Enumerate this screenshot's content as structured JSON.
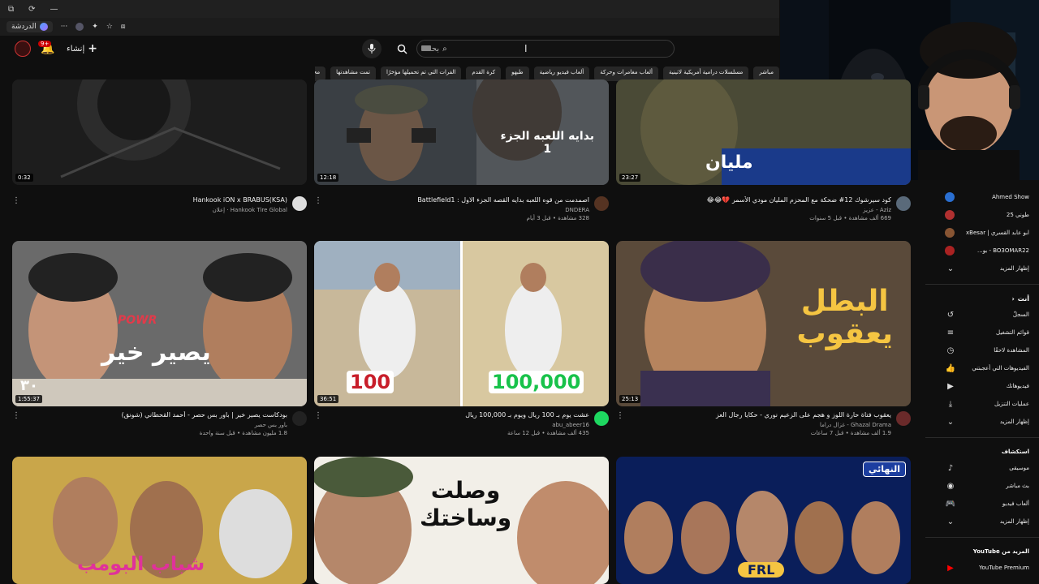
{
  "window": {
    "min": "—",
    "restore": "◻",
    "close": "▭"
  },
  "browser": {
    "profile_label": "الدردشة",
    "menu_dots": "···"
  },
  "header": {
    "create_label": "إنشاء",
    "notifications_count": "9+",
    "search_placeholder": "بحث"
  },
  "chips": [
    "مباشر",
    "مسلسلات درامية أمريكية لاتينية",
    "ألعاب مغامرات وحركة",
    "ألعاب فيديو رياضية",
    "طبهو",
    "كرة القدم",
    "الفرات التي تم تحميلها مؤخرًا",
    "تمت مشاهدتها",
    "محتوى جديد لك"
  ],
  "videos": [
    {
      "title": "Hankook iON x BRABUS(KSA)",
      "channel": "Hankook Tire Global · إعلان",
      "stats": "",
      "duration": "0:32"
    },
    {
      "title": "اصمدمت من قوه اللعبه بدايه القصه الجزء الاول : Battlefield1",
      "channel": "DNDERA",
      "stats": "328 مشاهدة • قبل 3 أيام",
      "duration": "12:18"
    },
    {
      "title": "كود سيرشوك 12# ضحكة مع المحزم المليان مودي الأسمر 💔😂😂",
      "channel": "Aziz - عزيز",
      "stats": "669 ألف مشاهدة • قبل 5 سنوات",
      "duration": "23:27"
    },
    {
      "title": "بودكاست يصير خير | باور بس حصر - أحمد القحطاني (شونق)",
      "channel": "باور بس حصر",
      "stats": "1.8 مليون مشاهدة • قبل سنة واحدة",
      "duration": "1:55:37"
    },
    {
      "title": "عشت يوم بـ 100 ريال ويوم بـ 100,000 ريال",
      "channel": "abu_abeer16",
      "stats": "435 ألف مشاهدة • قبل 12 ساعة",
      "duration": "36:51"
    },
    {
      "title": "يعقوب فتاة حارة اللوز و هجم على الزعيم نوري - حكايا رجال العز",
      "channel": "Ghazal Drama - غزال دراما",
      "stats": "1.9 ألف مشاهدة • قبل 7 ساعات",
      "duration": "25:13"
    }
  ],
  "thumb_text": {
    "v2_line1": "بدايه اللعبه الجزء",
    "v2_line2": "1",
    "v3": "مليان",
    "v4_powr": "POWR",
    "v4_main": "يصير خير",
    "v4_num": "٣٠",
    "v5_left": "100",
    "v5_right": "100,000",
    "v6_line1": "البطل",
    "v6_line2": "يعقوب",
    "v7": "شباب البومب",
    "v8_line1": "وصلت",
    "v8_line2": "وساختك",
    "v9_badge": "النهائي",
    "v9_logo": "FRL"
  },
  "sidebar": {
    "subscriptions": [
      {
        "label": "Ahmed Show",
        "color": "#2a6fd1"
      },
      {
        "label": "طوني 25",
        "color": "#b03030"
      },
      {
        "label": "ابو عابد القسري | xBesar",
        "color": "#885533"
      },
      {
        "label": "BO3OMAR22 - بو...",
        "color": "#aa2222"
      }
    ],
    "show_more": "إظهار المزيد",
    "you_header": "أنت",
    "you_items": [
      {
        "label": "السجلّ",
        "icon": "↺"
      },
      {
        "label": "قوائم التشغيل",
        "icon": "≡"
      },
      {
        "label": "المشاهدة لاحقًا",
        "icon": "◷"
      },
      {
        "label": "الفيديوهات التي أعجبتني",
        "icon": "👍"
      },
      {
        "label": "فيديوهاتك",
        "icon": "▶"
      },
      {
        "label": "عمليات التنزيل",
        "icon": "⤓"
      }
    ],
    "show_more2": "إظهار المزيد",
    "explore_header": "استكشاف",
    "explore_items": [
      {
        "label": "موسيقى",
        "icon": "♪"
      },
      {
        "label": "بث مباشر",
        "icon": "◉"
      },
      {
        "label": "ألعاب فيديو",
        "icon": "🎮"
      }
    ],
    "show_more3": "إظهار المزيد",
    "more_header": "المزيد من YouTube",
    "premium": "YouTube Premium"
  }
}
